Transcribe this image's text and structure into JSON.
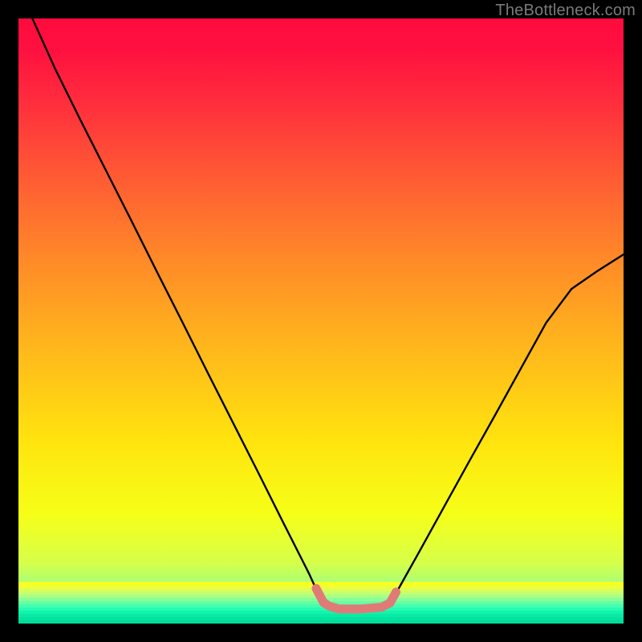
{
  "watermark": {
    "text": "TheBottleneck.com"
  },
  "colors": {
    "page_bg": "#000000",
    "curve_stroke": "#000000",
    "highlight_stroke": "#e07a77",
    "watermark": "#7a7a7a",
    "gradient_top": "#ff0b3e",
    "gradient_bottom": "#00e7a0"
  },
  "chart_data": {
    "type": "line",
    "title": "",
    "xlabel": "",
    "ylabel": "",
    "xlim": [
      0,
      100
    ],
    "ylim": [
      0,
      100
    ],
    "grid": false,
    "legend": false,
    "series": [
      {
        "name": "bottleneck-curve",
        "x": [
          0,
          2.3,
          6.1,
          10.2,
          14.4,
          18.6,
          22.8,
          27.0,
          31.2,
          35.4,
          39.6,
          43.8,
          48.0,
          49.6,
          51.2,
          53.0,
          56.5,
          60.0,
          62.0,
          66.2,
          70.4,
          74.6,
          78.8,
          83.0,
          87.2,
          91.4,
          95.6,
          100.0
        ],
        "y": [
          108,
          100,
          91.6,
          83.3,
          75.0,
          66.7,
          58.3,
          50.0,
          41.6,
          33.3,
          25.0,
          16.6,
          8.3,
          4.8,
          3.0,
          2.4,
          2.4,
          2.7,
          4.3,
          11.8,
          19.4,
          27.0,
          34.5,
          42.1,
          49.7,
          55.3,
          58.2,
          61.0
        ]
      },
      {
        "name": "sweet-spot-highlight",
        "x": [
          49.2,
          50.4,
          51.3,
          53.0,
          56.5,
          60.0,
          61.4,
          62.4
        ],
        "y": [
          5.8,
          3.5,
          2.9,
          2.4,
          2.4,
          2.7,
          3.4,
          5.2
        ]
      }
    ]
  }
}
